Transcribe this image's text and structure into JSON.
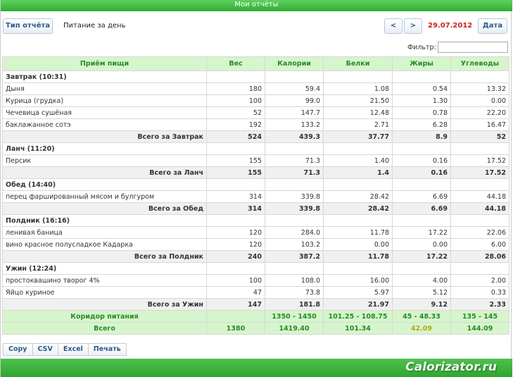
{
  "window": {
    "title": "Мои отчёты"
  },
  "toolbar": {
    "report_type_label": "Тип отчёта",
    "report_name": "Питание за день",
    "prev_label": "<",
    "next_label": ">",
    "date": "29.07.2012",
    "date_button_label": "Дата",
    "filter_label": "Фильтр:",
    "filter_value": ""
  },
  "table": {
    "columns": [
      "Приём пищи",
      "Вес",
      "Калории",
      "Белки",
      "Жиры",
      "Углеводы"
    ],
    "meals": [
      {
        "name": "Завтрак (10:31)",
        "items": [
          [
            "Дыня",
            "180",
            "59.4",
            "1.08",
            "0.54",
            "13.32"
          ],
          [
            "Курица (грудка)",
            "100",
            "99.0",
            "21.50",
            "1.30",
            "0.00"
          ],
          [
            "Чечевица сушёная",
            "52",
            "147.7",
            "12.48",
            "0.78",
            "22.20"
          ],
          [
            "баклажанное сотэ",
            "192",
            "133.2",
            "2.71",
            "6.28",
            "16.47"
          ]
        ],
        "total": [
          "Всего за Завтрак",
          "524",
          "439.3",
          "37.77",
          "8.9",
          "52"
        ]
      },
      {
        "name": "Ланч (11:20)",
        "items": [
          [
            "Персик",
            "155",
            "71.3",
            "1.40",
            "0.16",
            "17.52"
          ]
        ],
        "total": [
          "Всего за Ланч",
          "155",
          "71.3",
          "1.4",
          "0.16",
          "17.52"
        ]
      },
      {
        "name": "Обед (14:40)",
        "items": [
          [
            "перец фаршированный мясом и булгуром",
            "314",
            "339.8",
            "28.42",
            "6.69",
            "44.18"
          ]
        ],
        "total": [
          "Всего за Обед",
          "314",
          "339.8",
          "28.42",
          "6.69",
          "44.18"
        ]
      },
      {
        "name": "Полдник (16:16)",
        "items": [
          [
            "ленивая баница",
            "120",
            "284.0",
            "11.78",
            "17.22",
            "22.06"
          ],
          [
            "вино красное полусладкое Кадарка",
            "120",
            "103.2",
            "0.00",
            "0.00",
            "6.00"
          ]
        ],
        "total": [
          "Всего за Полдник",
          "240",
          "387.2",
          "11.78",
          "17.22",
          "28.06"
        ]
      },
      {
        "name": "Ужин (12:24)",
        "items": [
          [
            "простоквашино творог 4%",
            "100",
            "108.0",
            "16.00",
            "4.00",
            "2.00"
          ],
          [
            "Яйцо куриное",
            "47",
            "73.8",
            "5.97",
            "5.12",
            "0.33"
          ]
        ],
        "total": [
          "Всего за Ужин",
          "147",
          "181.8",
          "21.97",
          "9.12",
          "2.33"
        ]
      }
    ],
    "corridor": [
      "Коридор питания",
      "",
      "1350 - 1450",
      "101.25 - 108.75",
      "45 - 48.33",
      "135 - 145"
    ],
    "grand_total": [
      "Всего",
      "1380",
      "1419.40",
      "101.34",
      "42.09",
      "144.09"
    ]
  },
  "export_buttons": [
    "Copy",
    "CSV",
    "Excel",
    "Печать"
  ],
  "watermark": "Calorizator.ru",
  "colors": {
    "accent_green": "#2fae2f",
    "header_bg": "#d6f5cc",
    "date_red": "#cc2222",
    "warn_yellow": "#b8a51a"
  }
}
